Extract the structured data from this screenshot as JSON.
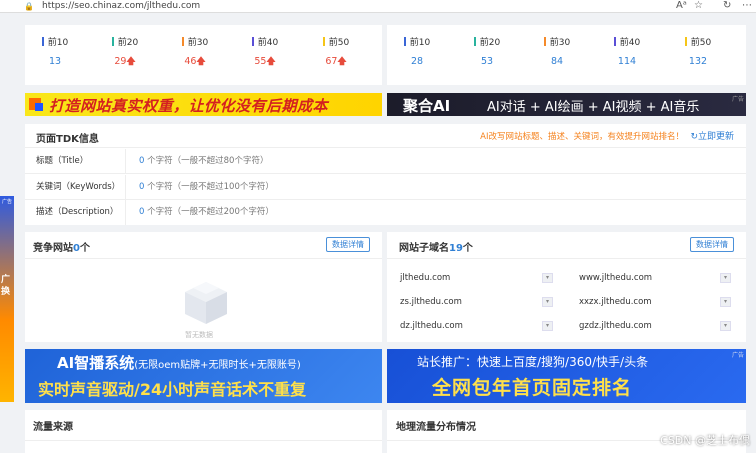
{
  "browser": {
    "url": "https://seo.chinaz.com/jlthedu.com",
    "toolbar_icons": [
      "read-aloud-icon",
      "star-icon",
      "refresh-icon",
      "more-icon"
    ]
  },
  "ranks_left": [
    {
      "label": "前10",
      "value": "13",
      "up": false,
      "color": "#3a66d6"
    },
    {
      "label": "前20",
      "value": "29",
      "up": true,
      "color": "#29b39e"
    },
    {
      "label": "前30",
      "value": "46",
      "up": true,
      "color": "#f58a2a"
    },
    {
      "label": "前40",
      "value": "55",
      "up": true,
      "color": "#5a4fd6"
    },
    {
      "label": "前50",
      "value": "67",
      "up": true,
      "color": "#f5c518"
    }
  ],
  "ranks_right": [
    {
      "label": "前10",
      "value": "28",
      "up": false,
      "color": "#3a66d6"
    },
    {
      "label": "前20",
      "value": "53",
      "up": false,
      "color": "#29b39e"
    },
    {
      "label": "前30",
      "value": "84",
      "up": false,
      "color": "#f58a2a"
    },
    {
      "label": "前40",
      "value": "114",
      "up": false,
      "color": "#5a4fd6"
    },
    {
      "label": "前50",
      "value": "132",
      "up": false,
      "color": "#f5c518"
    }
  ],
  "banner1": {
    "text": "打造网站真实权重，让优化没有后期成本"
  },
  "banner2": {
    "logo": "聚合AI",
    "text": "AI对话 + AI绘画 + AI视频 + AI音乐",
    "ad": "广告"
  },
  "tdk": {
    "title": "页面TDK信息",
    "hint": "AI改写网站标题、描述、关键词，有效提升网站排名！",
    "update": "立即更新",
    "rows": [
      {
        "key": "标题（Title）",
        "count": "0",
        "text": "个字符（一般不超过80个字符）"
      },
      {
        "key": "关键词（KeyWords）",
        "count": "0",
        "text": "个字符（一般不超过100个字符）"
      },
      {
        "key": "描述（Description）",
        "count": "0",
        "text": "个字符（一般不超过200个字符）"
      }
    ]
  },
  "competitor": {
    "title": "竞争网站",
    "count": "0",
    "unit": "个",
    "button": "数据详情",
    "empty": "暂无数据"
  },
  "subdomains": {
    "title": "网站子域名",
    "count": "19",
    "unit": "个",
    "button": "数据详情",
    "items": [
      "jlthedu.com",
      "www.jlthedu.com",
      "zs.jlthedu.com",
      "xxzx.jlthedu.com",
      "dz.jlthedu.com",
      "gzdz.jlthedu.com"
    ]
  },
  "banner3": {
    "line1_big": "AI智播系统",
    "line1_small": "(无限oem贴牌+无限时长+无限账号)",
    "line2": "实时声音驱动/24小时声音话术不重复"
  },
  "banner4": {
    "line1": "站长推广：快速上百度/搜狗/360/快手/头条",
    "line2": "全网包年首页固定排名",
    "ad": "广告"
  },
  "flow": {
    "left_title": "流量来源",
    "right_title": "地理流量分布情况"
  },
  "side_ad": {
    "tag": "广告",
    "text": "广\n换"
  },
  "watermark": "CSDN @芝士布偶"
}
